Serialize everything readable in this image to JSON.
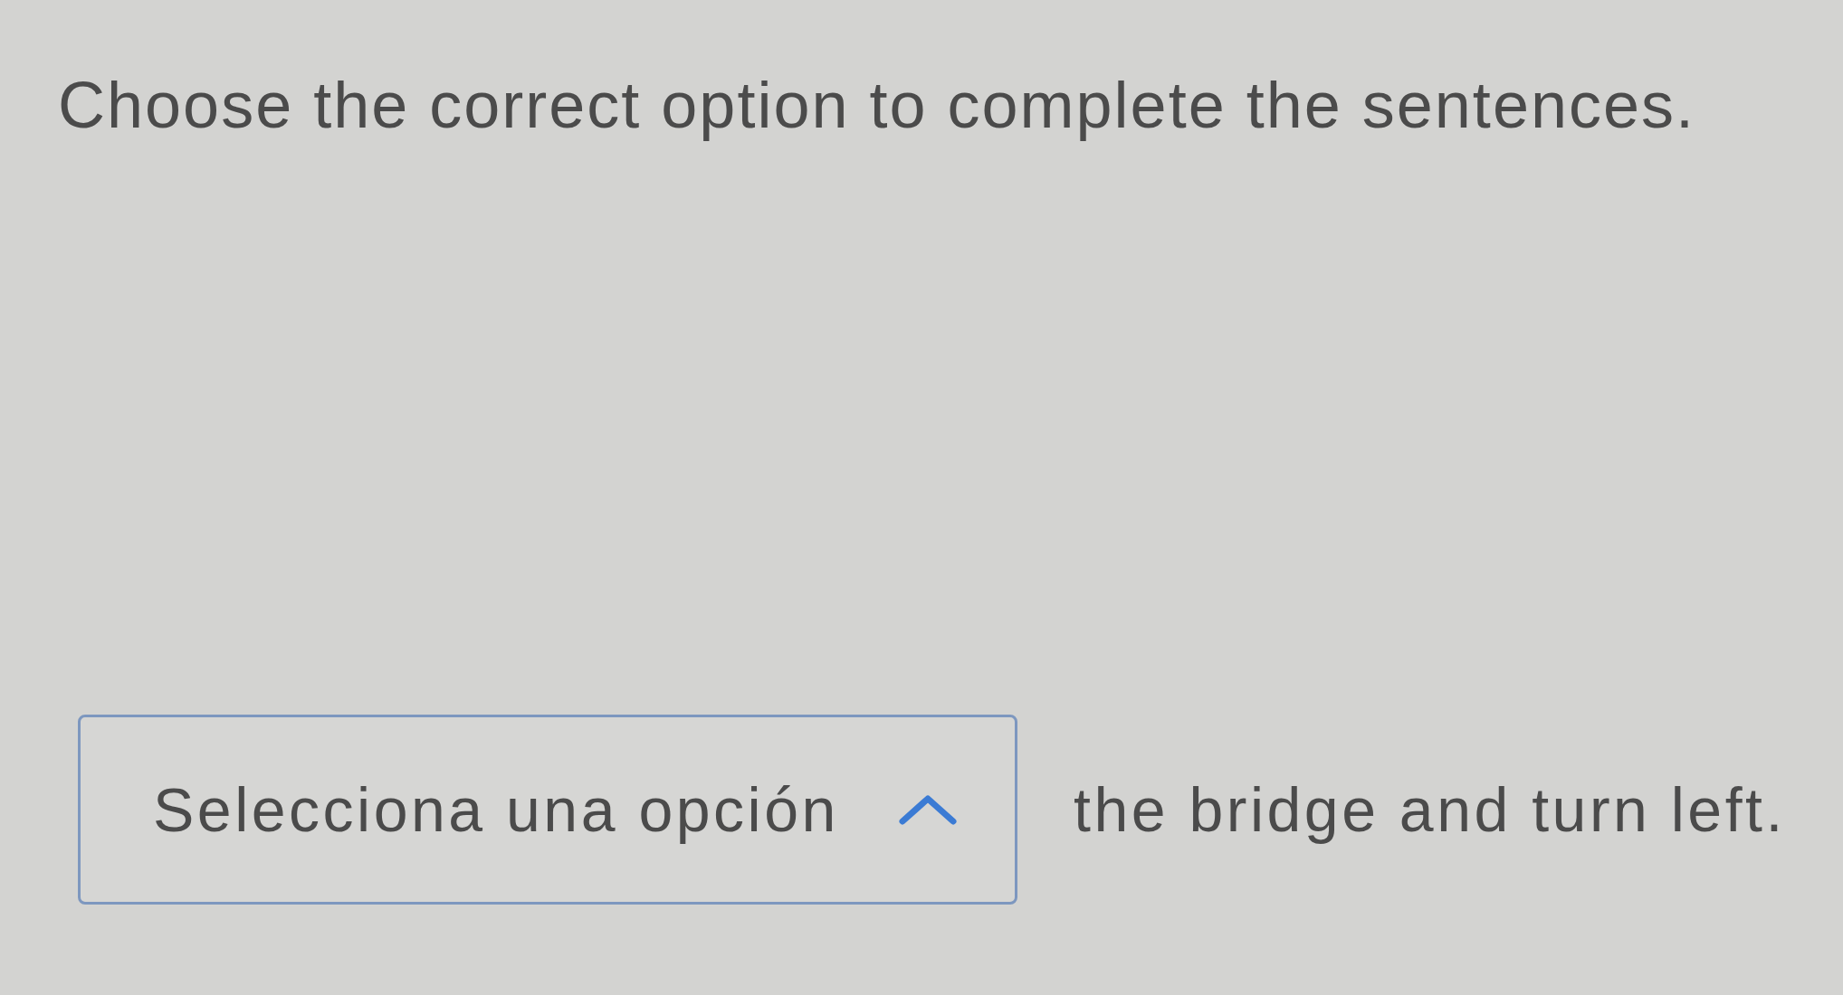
{
  "instruction": "Choose the correct option to complete the sentences.",
  "question": {
    "dropdown": {
      "placeholder": "Selecciona una opción",
      "expanded": true
    },
    "sentence_after": "the bridge and turn left."
  }
}
